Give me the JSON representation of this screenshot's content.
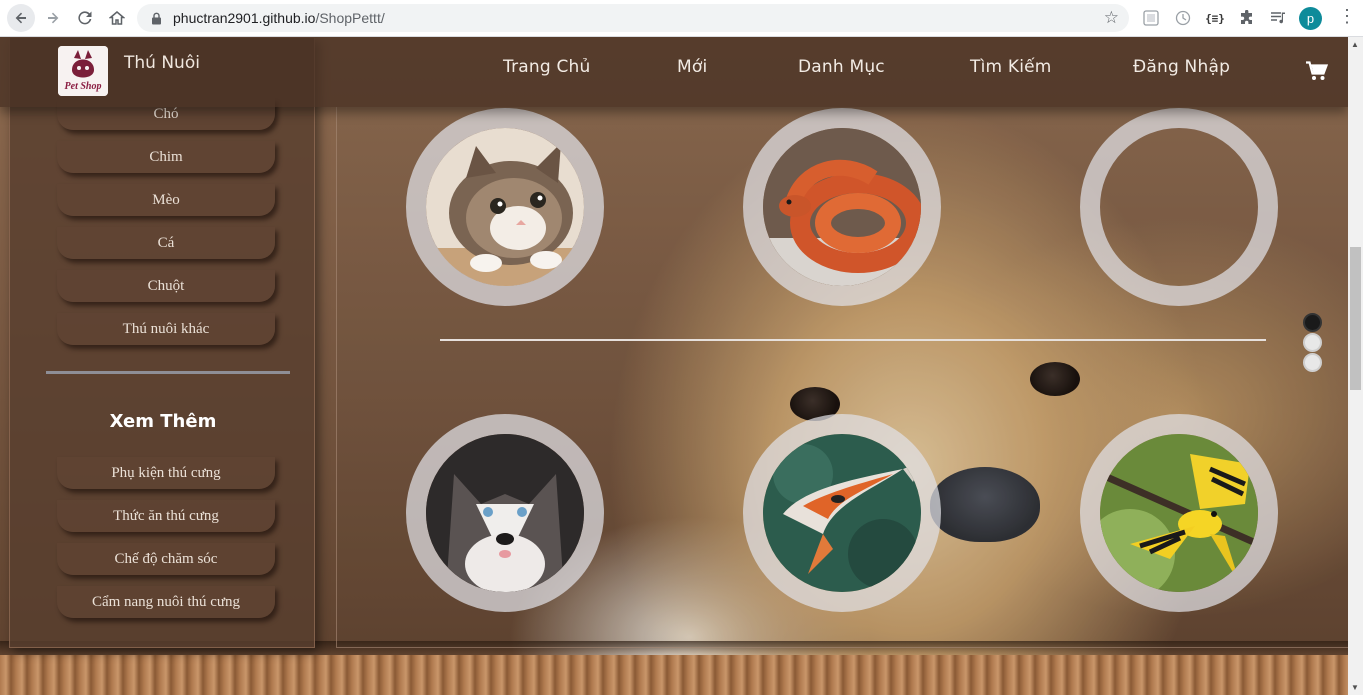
{
  "browser": {
    "url_host": "phuctran2901.github.io",
    "url_path": "/ShopPettt/",
    "profile_initial": "p",
    "ext3_label": "{≡}",
    "icons": [
      "back-arrow-icon",
      "forward-arrow-icon",
      "reload-icon",
      "home-icon",
      "lock-icon",
      "star-icon",
      "extension-icon",
      "puzzle-icon",
      "media-icon",
      "more-vert-icon"
    ]
  },
  "nav": {
    "home": "Trang Chủ",
    "new": "Mới",
    "categories": "Danh Mục",
    "search": "Tìm Kiếm",
    "login": "Đăng Nhập",
    "cart_icon": "cart-icon"
  },
  "sidebar": {
    "brand_title": "Thú Nuôi",
    "logo_text": "Pet Shop",
    "items": [
      {
        "label": "Chó"
      },
      {
        "label": "Chim"
      },
      {
        "label": "Mèo"
      },
      {
        "label": "Cá"
      },
      {
        "label": "Chuột"
      },
      {
        "label": "Thú nuôi khác"
      }
    ],
    "more_title": "Xem Thêm",
    "more_items": [
      {
        "label": "Phụ kiện thú cưng"
      },
      {
        "label": "Thức ăn thú cưng"
      },
      {
        "label": "Chế độ chăm sóc"
      },
      {
        "label": "Cẩm nang nuôi thú cưng"
      }
    ]
  },
  "gallery": {
    "top_row": [
      "cat-image",
      "snake-image",
      "empty-image"
    ],
    "bottom_row": [
      "husky-image",
      "koi-fish-image",
      "yellow-bird-image"
    ]
  },
  "slider": {
    "dot_count": 3,
    "active_index": 0
  },
  "colors": {
    "nav_bg": "#463023",
    "sidebar_bg": "#583e2e",
    "text_light": "#f2ebe4",
    "profile_bg": "#0e8b9a"
  }
}
